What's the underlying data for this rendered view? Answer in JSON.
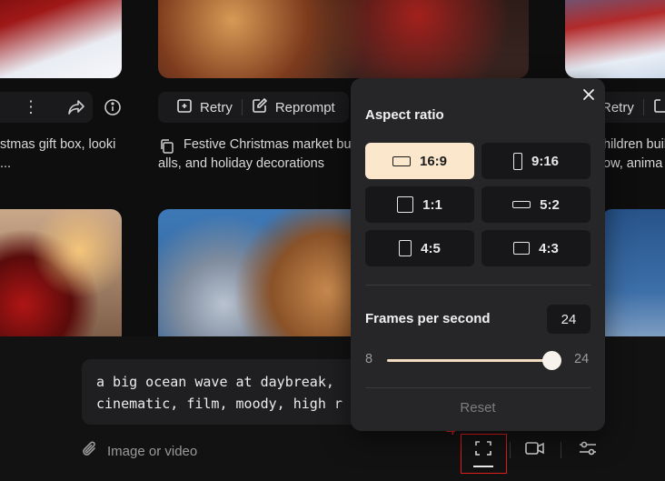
{
  "feed": {
    "actions": {
      "retry_label": "Retry",
      "reprompt_label": "Reprompt",
      "retry_right_label": "Retry"
    },
    "captions": {
      "left_line1": "stmas gift box, looki",
      "left_line2": "...",
      "mid_line1": "Festive Christmas market bu",
      "mid_line2": "alls, and holiday decorations",
      "right_line1": "hildren buil",
      "right_line2": "ow, anima"
    }
  },
  "composer": {
    "prompt_line1": "a big ocean wave at daybreak,",
    "prompt_line2": "cinematic, film, moody, high r",
    "attach_label": "Image or video"
  },
  "annotation": {
    "marker_label": "4",
    "marker_color": "#e01c1c"
  },
  "settings_popup": {
    "aspect_title": "Aspect ratio",
    "aspect_options": [
      {
        "label": "16:9",
        "selected": true
      },
      {
        "label": "9:16",
        "selected": false
      },
      {
        "label": "1:1",
        "selected": false
      },
      {
        "label": "5:2",
        "selected": false
      },
      {
        "label": "4:5",
        "selected": false
      },
      {
        "label": "4:3",
        "selected": false
      }
    ],
    "fps_title": "Frames per second",
    "fps_value": "24",
    "fps_min": "8",
    "fps_max": "24",
    "fps_fill_fraction": 1.0,
    "reset_label": "Reset",
    "accent_color": "#fbe7cc"
  }
}
